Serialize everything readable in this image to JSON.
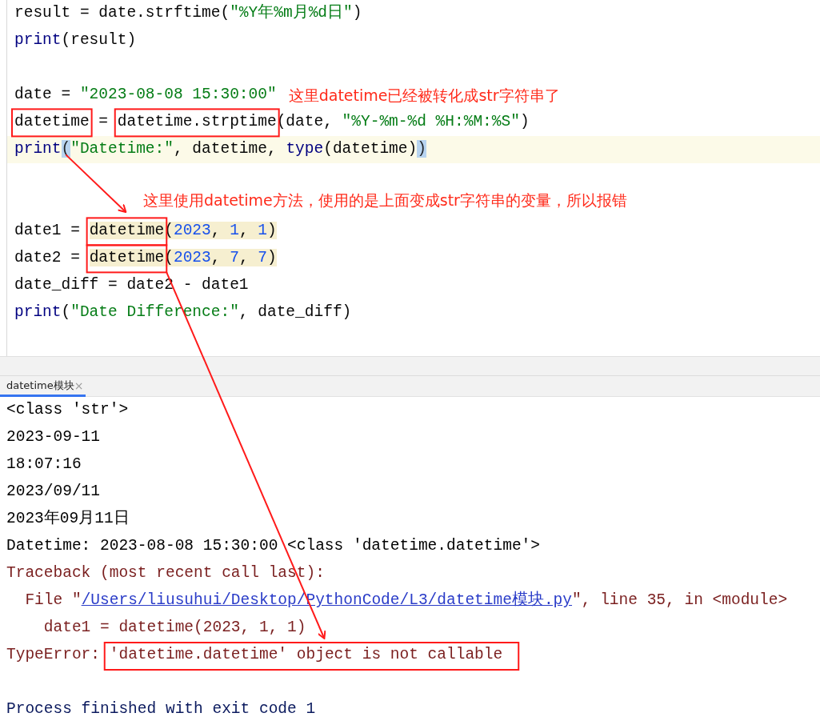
{
  "editor": {
    "lines": [
      {
        "kind": "code",
        "tokens": [
          {
            "text": "result = date.strftime(",
            "kind": "plain"
          },
          {
            "text": "\"%Y年%m月%d日\"",
            "kind": "string"
          },
          {
            "text": ")",
            "kind": "plain"
          }
        ]
      },
      {
        "kind": "code",
        "tokens": [
          {
            "text": "print",
            "kind": "builtin"
          },
          {
            "text": "(result)",
            "kind": "plain"
          }
        ]
      },
      {
        "kind": "blank"
      },
      {
        "kind": "code",
        "tokens": [
          {
            "text": "date = ",
            "kind": "plain"
          },
          {
            "text": "\"2023-08-08 15:30:00\"",
            "kind": "string"
          }
        ],
        "note": "这里datetime已经被转化成str字符串了"
      },
      {
        "kind": "code",
        "tokens": [
          {
            "text": "datetime",
            "kind": "plain",
            "boxed": true
          },
          {
            "text": " = ",
            "kind": "plain"
          },
          {
            "text": "datetime.strptime",
            "kind": "plain",
            "boxed": true
          },
          {
            "text": "(date, ",
            "kind": "plain"
          },
          {
            "text": "\"%Y-%m-%d %H:%M:%S\"",
            "kind": "string"
          },
          {
            "text": ")",
            "kind": "plain"
          }
        ]
      },
      {
        "kind": "code",
        "current": true,
        "tokens": [
          {
            "text": "print",
            "kind": "builtin"
          },
          {
            "text": "(",
            "kind": "brace"
          },
          {
            "text": "\"Datetime:\"",
            "kind": "string"
          },
          {
            "text": ", datetime, ",
            "kind": "plain"
          },
          {
            "text": "type",
            "kind": "builtin"
          },
          {
            "text": "(datetime)",
            "kind": "plain"
          },
          {
            "text": ")",
            "kind": "brace"
          }
        ]
      },
      {
        "kind": "blank"
      },
      {
        "kind": "note",
        "note": "这里使用datetime方法，使用的是上面变成str字符串的变量，所以报错"
      },
      {
        "kind": "code",
        "tokens": [
          {
            "text": "date1 = ",
            "kind": "plain"
          },
          {
            "text": "datetime",
            "kind": "plain",
            "boxed": true,
            "highlighted": true
          },
          {
            "text": "(",
            "kind": "plain",
            "highlighted": true
          },
          {
            "text": "2023",
            "kind": "number",
            "highlighted": true
          },
          {
            "text": ", ",
            "kind": "plain",
            "highlighted": true
          },
          {
            "text": "1",
            "kind": "number",
            "highlighted": true
          },
          {
            "text": ", ",
            "kind": "plain",
            "highlighted": true
          },
          {
            "text": "1",
            "kind": "number",
            "highlighted": true
          },
          {
            "text": ")",
            "kind": "plain",
            "highlighted": true
          }
        ]
      },
      {
        "kind": "code",
        "tokens": [
          {
            "text": "date2 = ",
            "kind": "plain"
          },
          {
            "text": "datetime",
            "kind": "plain",
            "boxed": true,
            "highlighted": true
          },
          {
            "text": "(",
            "kind": "plain",
            "highlighted": true
          },
          {
            "text": "2023",
            "kind": "number",
            "highlighted": true
          },
          {
            "text": ", ",
            "kind": "plain",
            "highlighted": true
          },
          {
            "text": "7",
            "kind": "number",
            "highlighted": true
          },
          {
            "text": ", ",
            "kind": "plain",
            "highlighted": true
          },
          {
            "text": "7",
            "kind": "number",
            "highlighted": true
          },
          {
            "text": ")",
            "kind": "plain",
            "highlighted": true
          }
        ]
      },
      {
        "kind": "code",
        "tokens": [
          {
            "text": "date_diff = date2 - date1",
            "kind": "plain"
          }
        ]
      },
      {
        "kind": "code",
        "tokens": [
          {
            "text": "print",
            "kind": "builtin"
          },
          {
            "text": "(",
            "kind": "plain"
          },
          {
            "text": "\"Date Difference:\"",
            "kind": "string"
          },
          {
            "text": ", date_diff)",
            "kind": "plain"
          }
        ]
      }
    ]
  },
  "console": {
    "tabs": [
      {
        "label": "datetime模块",
        "close": "×",
        "selected": true
      }
    ],
    "lines": [
      {
        "kind": "output",
        "segments": [
          {
            "text": "<class 'str'>",
            "kind": "plain"
          }
        ]
      },
      {
        "kind": "output",
        "segments": [
          {
            "text": "2023-09-11",
            "kind": "plain"
          }
        ]
      },
      {
        "kind": "output",
        "segments": [
          {
            "text": "18:07:16",
            "kind": "plain"
          }
        ]
      },
      {
        "kind": "output",
        "segments": [
          {
            "text": "2023/09/11",
            "kind": "plain"
          }
        ]
      },
      {
        "kind": "output",
        "segments": [
          {
            "text": "2023年09月11日",
            "kind": "plain"
          }
        ]
      },
      {
        "kind": "output",
        "segments": [
          {
            "text": "Datetime: 2023-08-08 15:30:00 <class 'datetime.datetime'>",
            "kind": "plain"
          }
        ]
      },
      {
        "kind": "error",
        "segments": [
          {
            "text": "Traceback (most recent call last):",
            "kind": "plain"
          }
        ]
      },
      {
        "kind": "error",
        "segments": [
          {
            "text": "  File \"",
            "kind": "plain"
          },
          {
            "text": "/Users/liusuhui/Desktop/PythonCode/L3/datetime模块.py",
            "kind": "link"
          },
          {
            "text": "\", line 35, in <module>",
            "kind": "plain"
          }
        ]
      },
      {
        "kind": "error",
        "segments": [
          {
            "text": "    date1 = datetime(2023, 1, 1)",
            "kind": "plain"
          }
        ]
      },
      {
        "kind": "error",
        "segments": [
          {
            "text": "TypeError: ",
            "kind": "plain"
          },
          {
            "text": "'datetime.datetime' object is not callable",
            "kind": "plain",
            "boxed": true
          }
        ]
      },
      {
        "kind": "blank"
      },
      {
        "kind": "exit",
        "segments": [
          {
            "text": "Process finished with exit code 1",
            "kind": "plain"
          }
        ]
      }
    ]
  }
}
